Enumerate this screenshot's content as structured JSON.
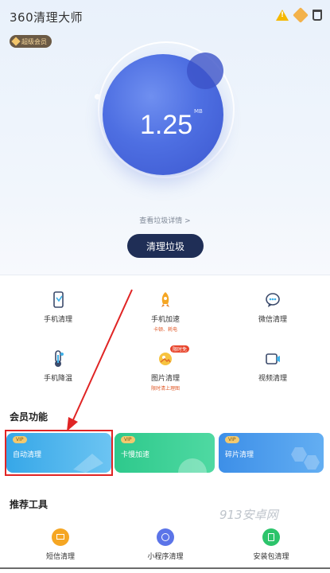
{
  "app": {
    "logo": "360清理大师",
    "vip_badge": "超级会员"
  },
  "header_icons": [
    "warning-icon",
    "vip-diamond-icon",
    "trash-icon"
  ],
  "gauge": {
    "value": "1.25",
    "unit": "MB"
  },
  "view_details": "查看垃圾详情 >",
  "clean_button": "清理垃圾",
  "tools": [
    {
      "label": "手机清理",
      "icon": "phone-clean-icon"
    },
    {
      "label": "手机加速",
      "icon": "rocket-icon",
      "sub": "卡顿、耗电"
    },
    {
      "label": "微信清理",
      "icon": "wechat-icon"
    },
    {
      "label": "手机降温",
      "icon": "thermometer-icon"
    },
    {
      "label": "图片清理",
      "icon": "image-clean-icon",
      "badge": "限时免",
      "sub": "限时清上理图"
    },
    {
      "label": "视频清理",
      "icon": "video-icon"
    }
  ],
  "member_section_title": "会员功能",
  "member_cards": [
    {
      "tag": "VIP",
      "label": "自动清理",
      "color": "#36a7e8"
    },
    {
      "tag": "VIP",
      "label": "卡慢加速",
      "color": "#2ec98c"
    },
    {
      "tag": "VIP",
      "label": "碎片清理",
      "color": "#3d8fe8"
    }
  ],
  "recommend_section_title": "推荐工具",
  "recommend": [
    {
      "label": "短信清理",
      "icon": "sms-icon",
      "color": "#f5a623"
    },
    {
      "label": "小程序清理",
      "icon": "miniprogram-icon",
      "color": "#5b74e8"
    },
    {
      "label": "安装包清理",
      "icon": "apk-icon",
      "color": "#2cc46b"
    }
  ],
  "watermark": "913安卓网"
}
